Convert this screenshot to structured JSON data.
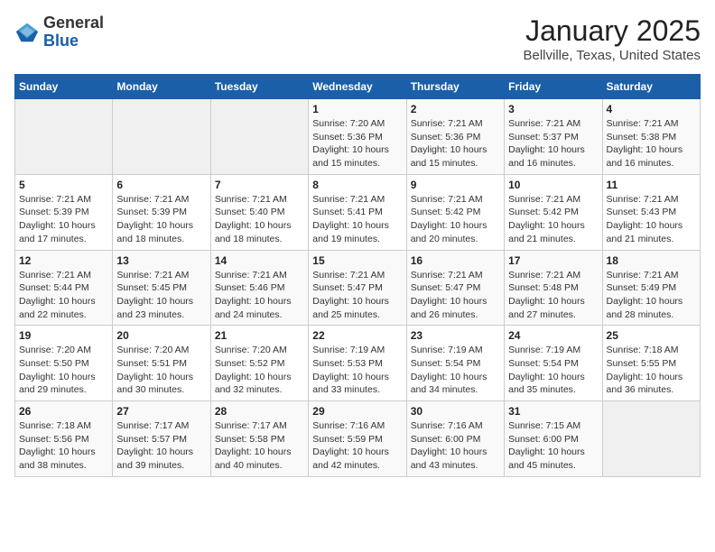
{
  "header": {
    "logo_line1": "General",
    "logo_line2": "Blue",
    "title": "January 2025",
    "subtitle": "Bellville, Texas, United States"
  },
  "weekdays": [
    "Sunday",
    "Monday",
    "Tuesday",
    "Wednesday",
    "Thursday",
    "Friday",
    "Saturday"
  ],
  "weeks": [
    [
      {
        "day": "",
        "empty": true
      },
      {
        "day": "",
        "empty": true
      },
      {
        "day": "",
        "empty": true
      },
      {
        "day": "1",
        "sunrise": "7:20 AM",
        "sunset": "5:36 PM",
        "daylight": "10 hours and 15 minutes."
      },
      {
        "day": "2",
        "sunrise": "7:21 AM",
        "sunset": "5:36 PM",
        "daylight": "10 hours and 15 minutes."
      },
      {
        "day": "3",
        "sunrise": "7:21 AM",
        "sunset": "5:37 PM",
        "daylight": "10 hours and 16 minutes."
      },
      {
        "day": "4",
        "sunrise": "7:21 AM",
        "sunset": "5:38 PM",
        "daylight": "10 hours and 16 minutes."
      }
    ],
    [
      {
        "day": "5",
        "sunrise": "7:21 AM",
        "sunset": "5:39 PM",
        "daylight": "10 hours and 17 minutes."
      },
      {
        "day": "6",
        "sunrise": "7:21 AM",
        "sunset": "5:39 PM",
        "daylight": "10 hours and 18 minutes."
      },
      {
        "day": "7",
        "sunrise": "7:21 AM",
        "sunset": "5:40 PM",
        "daylight": "10 hours and 18 minutes."
      },
      {
        "day": "8",
        "sunrise": "7:21 AM",
        "sunset": "5:41 PM",
        "daylight": "10 hours and 19 minutes."
      },
      {
        "day": "9",
        "sunrise": "7:21 AM",
        "sunset": "5:42 PM",
        "daylight": "10 hours and 20 minutes."
      },
      {
        "day": "10",
        "sunrise": "7:21 AM",
        "sunset": "5:42 PM",
        "daylight": "10 hours and 21 minutes."
      },
      {
        "day": "11",
        "sunrise": "7:21 AM",
        "sunset": "5:43 PM",
        "daylight": "10 hours and 21 minutes."
      }
    ],
    [
      {
        "day": "12",
        "sunrise": "7:21 AM",
        "sunset": "5:44 PM",
        "daylight": "10 hours and 22 minutes."
      },
      {
        "day": "13",
        "sunrise": "7:21 AM",
        "sunset": "5:45 PM",
        "daylight": "10 hours and 23 minutes."
      },
      {
        "day": "14",
        "sunrise": "7:21 AM",
        "sunset": "5:46 PM",
        "daylight": "10 hours and 24 minutes."
      },
      {
        "day": "15",
        "sunrise": "7:21 AM",
        "sunset": "5:47 PM",
        "daylight": "10 hours and 25 minutes."
      },
      {
        "day": "16",
        "sunrise": "7:21 AM",
        "sunset": "5:47 PM",
        "daylight": "10 hours and 26 minutes."
      },
      {
        "day": "17",
        "sunrise": "7:21 AM",
        "sunset": "5:48 PM",
        "daylight": "10 hours and 27 minutes."
      },
      {
        "day": "18",
        "sunrise": "7:21 AM",
        "sunset": "5:49 PM",
        "daylight": "10 hours and 28 minutes."
      }
    ],
    [
      {
        "day": "19",
        "sunrise": "7:20 AM",
        "sunset": "5:50 PM",
        "daylight": "10 hours and 29 minutes."
      },
      {
        "day": "20",
        "sunrise": "7:20 AM",
        "sunset": "5:51 PM",
        "daylight": "10 hours and 30 minutes."
      },
      {
        "day": "21",
        "sunrise": "7:20 AM",
        "sunset": "5:52 PM",
        "daylight": "10 hours and 32 minutes."
      },
      {
        "day": "22",
        "sunrise": "7:19 AM",
        "sunset": "5:53 PM",
        "daylight": "10 hours and 33 minutes."
      },
      {
        "day": "23",
        "sunrise": "7:19 AM",
        "sunset": "5:54 PM",
        "daylight": "10 hours and 34 minutes."
      },
      {
        "day": "24",
        "sunrise": "7:19 AM",
        "sunset": "5:54 PM",
        "daylight": "10 hours and 35 minutes."
      },
      {
        "day": "25",
        "sunrise": "7:18 AM",
        "sunset": "5:55 PM",
        "daylight": "10 hours and 36 minutes."
      }
    ],
    [
      {
        "day": "26",
        "sunrise": "7:18 AM",
        "sunset": "5:56 PM",
        "daylight": "10 hours and 38 minutes."
      },
      {
        "day": "27",
        "sunrise": "7:17 AM",
        "sunset": "5:57 PM",
        "daylight": "10 hours and 39 minutes."
      },
      {
        "day": "28",
        "sunrise": "7:17 AM",
        "sunset": "5:58 PM",
        "daylight": "10 hours and 40 minutes."
      },
      {
        "day": "29",
        "sunrise": "7:16 AM",
        "sunset": "5:59 PM",
        "daylight": "10 hours and 42 minutes."
      },
      {
        "day": "30",
        "sunrise": "7:16 AM",
        "sunset": "6:00 PM",
        "daylight": "10 hours and 43 minutes."
      },
      {
        "day": "31",
        "sunrise": "7:15 AM",
        "sunset": "6:00 PM",
        "daylight": "10 hours and 45 minutes."
      },
      {
        "day": "",
        "empty": true
      }
    ]
  ],
  "labels": {
    "sunrise": "Sunrise:",
    "sunset": "Sunset:",
    "daylight": "Daylight:"
  }
}
